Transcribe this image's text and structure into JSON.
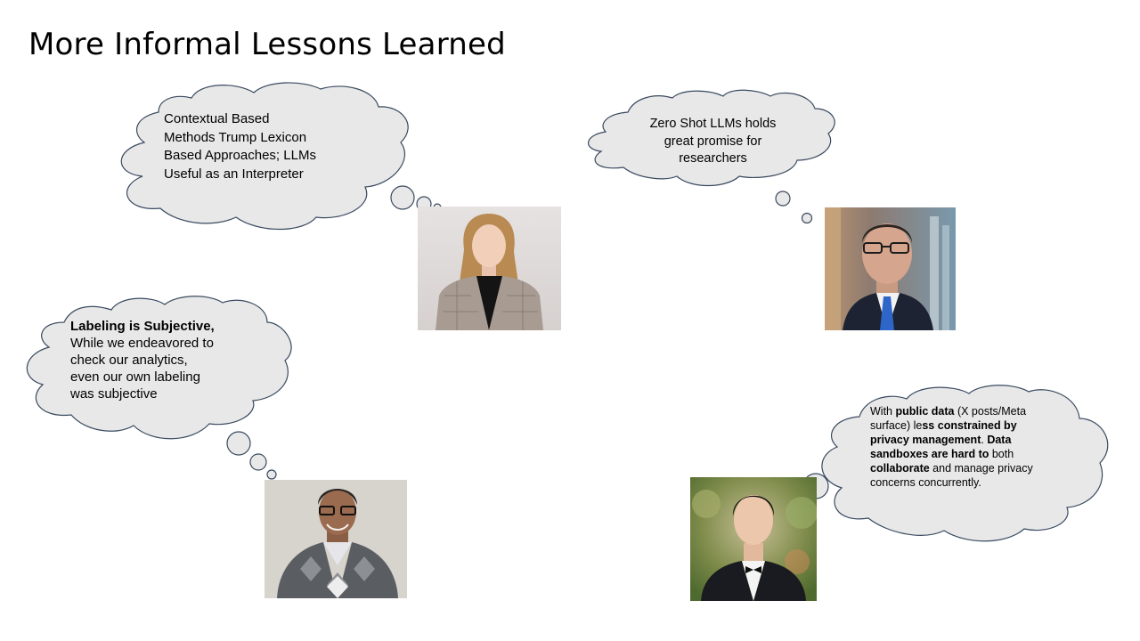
{
  "slide": {
    "title": "More Informal Lessons Learned"
  },
  "bubbles": {
    "contextual": {
      "line1": "Contextual Based",
      "line2": "Methods Trump Lexicon",
      "line3": "Based Approaches; LLMs",
      "line4": "Useful as an Interpreter"
    },
    "zero_shot": {
      "line1": "Zero Shot LLMs holds",
      "line2": "great promise for",
      "line3": "researchers"
    },
    "labeling": {
      "heading": "Labeling is Subjective,",
      "line1": "While we endeavored to",
      "line2": "check our analytics,",
      "line3": "even our own labeling",
      "line4": "was subjective"
    },
    "public_data": {
      "p1": "With ",
      "b1": "public data",
      "p2": " (X posts/Meta surface) le",
      "b2": "ss constrained by privacy management",
      "p3": ".  ",
      "b3": "Data sandboxes are hard to",
      "p4": " both ",
      "b4": "collaborate",
      "p5": " and manage privacy concerns concurrently."
    }
  }
}
